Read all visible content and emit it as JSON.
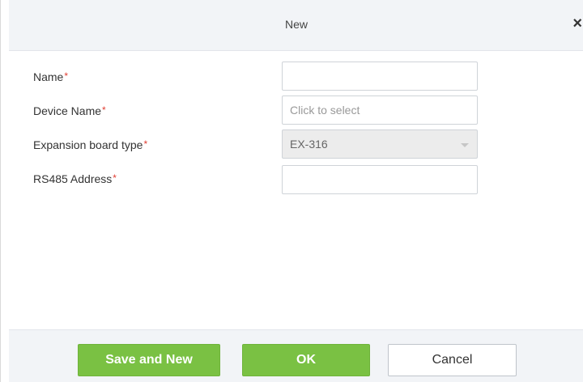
{
  "dialog": {
    "title": "New",
    "close_glyph": "×"
  },
  "form": {
    "required_mark": "*",
    "fields": [
      {
        "label": "Name",
        "value": "",
        "placeholder": ""
      },
      {
        "label": "Device Name",
        "value": "",
        "placeholder": "Click to select"
      },
      {
        "label": "Expansion board type",
        "value": "EX-316",
        "placeholder": ""
      },
      {
        "label": "RS485 Address",
        "value": "",
        "placeholder": ""
      }
    ]
  },
  "footer": {
    "save_new_label": "Save and New",
    "ok_label": "OK",
    "cancel_label": "Cancel"
  },
  "colors": {
    "primary_green": "#7ac143",
    "required_red": "#e03c31",
    "header_bg": "#f2f4f7"
  }
}
